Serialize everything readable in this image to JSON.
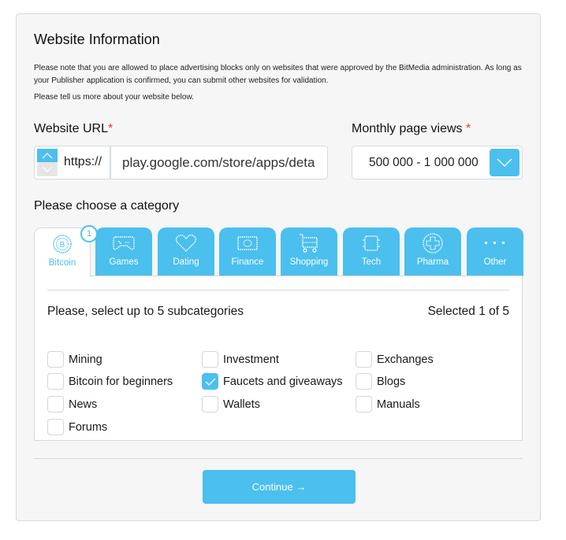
{
  "header": {
    "title": "Website Information",
    "note": "Please note that you are allowed to place advertising blocks only on websites that were approved by the BitMedia administration. As long as your Publisher application is confirmed, you can submit other websites for validation.",
    "note2": "Please tell us more about your website below."
  },
  "url_field": {
    "label": "Website URL",
    "required_mark": "*",
    "protocol": "https://",
    "value": "play.google.com/store/apps/deta"
  },
  "views_field": {
    "label": "Monthly page views",
    "required_mark": "*",
    "selected": "500 000 - 1 000 000"
  },
  "category": {
    "label": "Please choose a category",
    "tabs": [
      {
        "label": "Bitcoin",
        "icon": "bitcoin-icon",
        "active": true,
        "badge": "1"
      },
      {
        "label": "Games",
        "icon": "gamepad-icon",
        "active": false
      },
      {
        "label": "Dating",
        "icon": "heart-icon",
        "active": false
      },
      {
        "label": "Finance",
        "icon": "banknote-icon",
        "active": false
      },
      {
        "label": "Shopping",
        "icon": "cart-icon",
        "active": false
      },
      {
        "label": "Tech",
        "icon": "chip-icon",
        "active": false
      },
      {
        "label": "Pharma",
        "icon": "medical-cross-icon",
        "active": false
      },
      {
        "label": "Other",
        "icon": "more-dots-icon",
        "active": false
      }
    ]
  },
  "subcategories": {
    "heading": "Please, select up to 5 subcategories",
    "count": "Selected 1 of 5",
    "items": [
      {
        "label": "Mining",
        "checked": false
      },
      {
        "label": "Investment",
        "checked": false
      },
      {
        "label": "Exchanges",
        "checked": false
      },
      {
        "label": "Bitcoin for beginners",
        "checked": false
      },
      {
        "label": "Faucets and giveaways",
        "checked": true
      },
      {
        "label": "Blogs",
        "checked": false
      },
      {
        "label": "News",
        "checked": false
      },
      {
        "label": "Wallets",
        "checked": false
      },
      {
        "label": "Manuals",
        "checked": false
      },
      {
        "label": "Forums",
        "checked": false
      }
    ]
  },
  "actions": {
    "continue_label": "Continue →"
  },
  "colors": {
    "accent": "#4bbfee",
    "required": "#e8363f"
  }
}
